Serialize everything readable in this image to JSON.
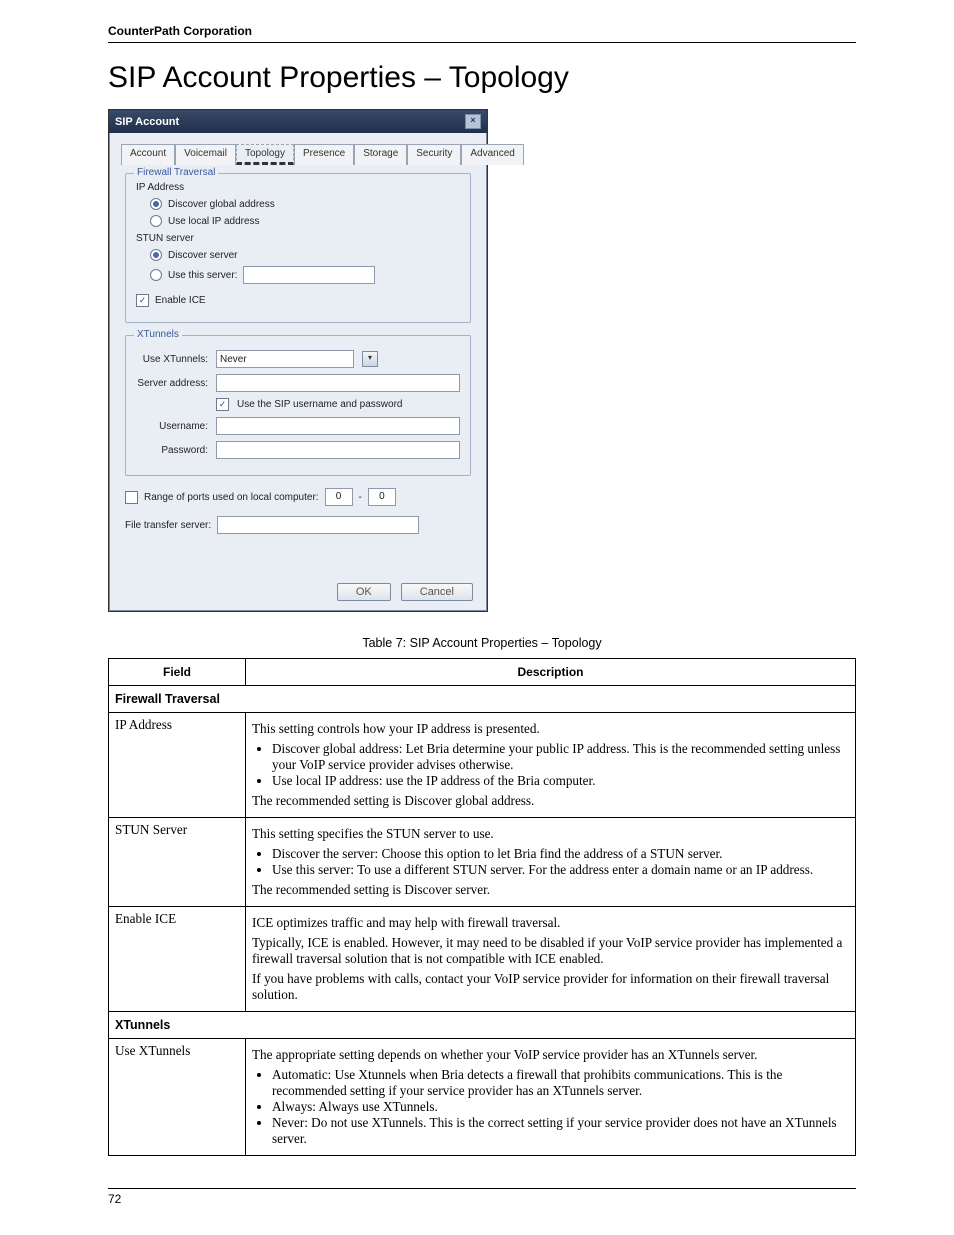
{
  "header": {
    "company": "CounterPath Corporation"
  },
  "title": "SIP Account Properties – Topology",
  "page_number": "72",
  "dialog": {
    "title": "SIP Account",
    "tabs": [
      "Account",
      "Voicemail",
      "Topology",
      "Presence",
      "Storage",
      "Security",
      "Advanced"
    ],
    "active_tab": "Topology",
    "firewall_group": "Firewall Traversal",
    "ip_address_label": "IP Address",
    "ip_option1": "Discover global address",
    "ip_option2": "Use local IP address",
    "stun_label": "STUN server",
    "stun_option1": "Discover server",
    "stun_option2": "Use this server:",
    "enable_ice": "Enable ICE",
    "xtunnels_group": "XTunnels",
    "use_xtunnels_label": "Use XTunnels:",
    "use_xtunnels_value": "Never",
    "server_address_label": "Server address:",
    "use_sip_cred": "Use the SIP username and password",
    "username_label": "Username:",
    "password_label": "Password:",
    "port_range_label": "Range of ports used on local computer:",
    "port_from": "0",
    "port_to": "0",
    "file_transfer_label": "File transfer server:",
    "ok": "OK",
    "cancel": "Cancel"
  },
  "caption": "Table 7: SIP Account Properties – Topology",
  "table": {
    "head_field": "Field",
    "head_desc": "Description",
    "section1": "Firewall Traversal",
    "r1_field": "IP Address",
    "r1_p1": "This setting controls how your IP address is presented.",
    "r1_li1": "Discover global address: Let Bria determine your public IP address. This is the recommended setting unless your VoIP service provider advises otherwise.",
    "r1_li2": "Use local IP address: use the IP address of the Bria computer.",
    "r1_p2": "The recommended setting is Discover global address.",
    "r2_field": "STUN Server",
    "r2_p1": "This setting specifies the STUN server to use.",
    "r2_li1": "Discover the server: Choose this option to let Bria find the address of a STUN server.",
    "r2_li2": "Use this server: To use a different STUN server. For the address enter a domain name or an IP address.",
    "r2_p2": "The recommended setting is Discover server.",
    "r3_field": "Enable ICE",
    "r3_p1": "ICE optimizes traffic and may help with firewall traversal.",
    "r3_p2": "Typically, ICE is enabled. However, it may need to be disabled if your VoIP service provider has implemented a firewall traversal solution that is not compatible with ICE enabled.",
    "r3_p3": "If you have problems with calls, contact your VoIP service provider for information on their firewall traversal solution.",
    "section2": "XTunnels",
    "r4_field": "Use XTunnels",
    "r4_p1": "The appropriate setting depends on whether your VoIP service provider has an XTunnels server.",
    "r4_li1": "Automatic: Use Xtunnels when Bria detects a firewall that prohibits communications. This is the recommended setting if your service provider has an XTunnels server.",
    "r4_li2": "Always: Always use XTunnels.",
    "r4_li3": "Never: Do not use XTunnels. This is the correct setting if your service provider does not have an XTunnels server."
  }
}
